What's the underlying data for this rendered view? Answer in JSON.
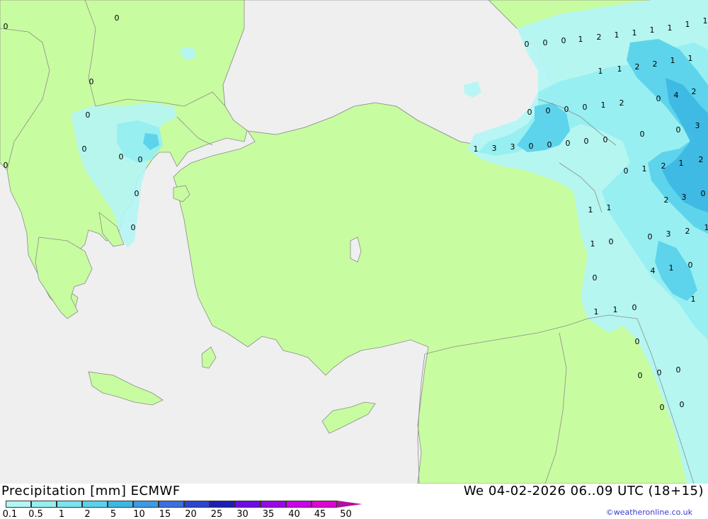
{
  "title": "Precipitation [mm] ECMWF",
  "datetime": "We 04-02-2026 06..09 UTC (18+15)",
  "credit": "©weatheronline.co.uk",
  "legend": {
    "ticks": [
      "0.1",
      "0.5",
      "1",
      "2",
      "5",
      "10",
      "15",
      "20",
      "25",
      "30",
      "35",
      "40",
      "45",
      "50"
    ],
    "colors": [
      "#b4f5f5",
      "#96eef0",
      "#78e4ee",
      "#5ad2ea",
      "#3cb8e4",
      "#3c9ae6",
      "#3c70e0",
      "#2c46d2",
      "#1e1eb4",
      "#6e0ce6",
      "#9a08e6",
      "#c806e6",
      "#e004d2",
      "#b010a0"
    ]
  },
  "map_colors": {
    "sea": "#efefef",
    "land": "#c8fca0",
    "precip_light": "#b4f5f5",
    "precip_medium": "#96eef0",
    "precip_strong": "#5ad2ea",
    "precip_heavy": "#3cb8e4",
    "border": "#8c8c8c"
  },
  "precip_values": [
    "0",
    "0",
    "0",
    "0",
    "0",
    "0",
    "0",
    "0",
    "0",
    "0",
    "0",
    "0",
    "0",
    "1",
    "2",
    "1",
    "1",
    "1",
    "1",
    "1",
    "1",
    "2",
    "2",
    "1",
    "1",
    "4",
    "2",
    "0",
    "3",
    "0",
    "1",
    "1",
    "0",
    "0",
    "0",
    "0",
    "1",
    "2",
    "1",
    "3",
    "3",
    "0",
    "0",
    "0",
    "0",
    "0",
    "0",
    "1",
    "2",
    "1",
    "0",
    "2",
    "2",
    "3",
    "0",
    "1",
    "1",
    "0",
    "3",
    "2",
    "1",
    "1",
    "0",
    "4",
    "1",
    "0",
    "0",
    "1",
    "1",
    "1",
    "0",
    "0",
    "0",
    "0",
    "0",
    "0",
    "0"
  ]
}
